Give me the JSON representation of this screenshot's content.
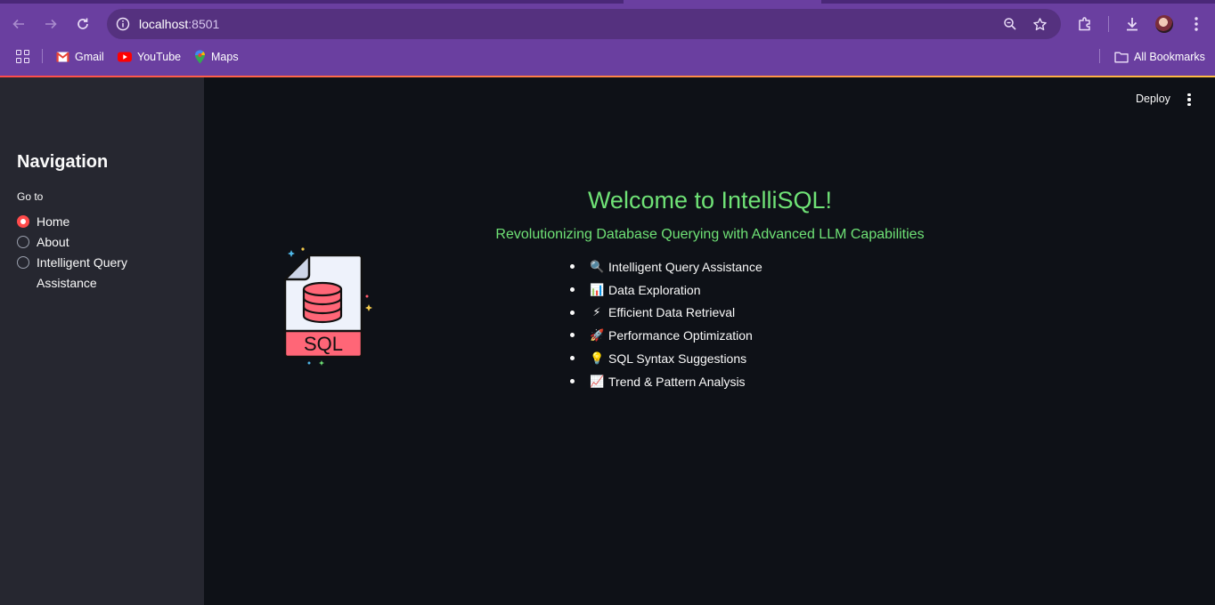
{
  "browser": {
    "url_host": "localhost",
    "url_port": ":8501",
    "bookmarks": [
      {
        "label": "Gmail",
        "icon": "gmail-icon"
      },
      {
        "label": "YouTube",
        "icon": "youtube-icon"
      },
      {
        "label": "Maps",
        "icon": "maps-icon"
      }
    ],
    "all_bookmarks_label": "All Bookmarks"
  },
  "app": {
    "deploy_label": "Deploy",
    "sidebar": {
      "title": "Navigation",
      "radio_label": "Go to",
      "options": [
        {
          "label": "Home",
          "selected": true
        },
        {
          "label": "About",
          "selected": false
        },
        {
          "label": "Intelligent Query Assistance",
          "selected": false
        }
      ]
    },
    "main": {
      "title": "Welcome to IntelliSQL!",
      "subtitle": "Revolutionizing Database Querying with Advanced LLM Capabilities",
      "image_label": "SQL",
      "features": [
        {
          "emoji": "🔍",
          "label": "Intelligent Query Assistance"
        },
        {
          "emoji": "📊",
          "label": "Data Exploration"
        },
        {
          "emoji": "⚡",
          "label": "Efficient Data Retrieval"
        },
        {
          "emoji": "🚀",
          "label": "Performance Optimization"
        },
        {
          "emoji": "💡",
          "label": "SQL Syntax Suggestions"
        },
        {
          "emoji": "📈",
          "label": "Trend & Pattern Analysis"
        }
      ]
    }
  },
  "colors": {
    "browser_frame": "#6a3fa0",
    "sidebar_bg": "#262730",
    "main_bg": "#0e1117",
    "accent_green": "#6fe276",
    "radio_selected": "#ff4b4b"
  }
}
